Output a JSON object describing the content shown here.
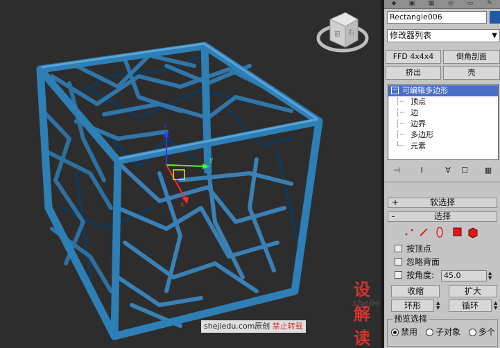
{
  "viewport": {
    "axis_x": "x",
    "axis_y": "y",
    "axis_z": "z",
    "viewcube_labels": [
      "前",
      "右"
    ]
  },
  "panel": {
    "object_name": "Rectangle006",
    "object_color": "#1f5aa6",
    "modifier_list": "修改器列表",
    "buttons": {
      "ffd": "FFD 4x4x4",
      "chamfer_profile": "倒角剖面",
      "extrude": "挤出",
      "shell": "壳"
    },
    "stack": {
      "root": "可编辑多边形",
      "items": [
        "顶点",
        "边",
        "边界",
        "多边形",
        "元素"
      ]
    },
    "rollouts": {
      "soft_selection": {
        "sign": "+",
        "label": "软选择"
      },
      "selection": {
        "sign": "-",
        "label": "选择"
      }
    },
    "options": {
      "by_vertex": "按顶点",
      "ignore_backfacing": "忽略背面",
      "by_angle": "按角度:",
      "angle_value": "45.0",
      "shrink": "收缩",
      "grow": "扩大",
      "ring": "环形",
      "loop": "循环",
      "preview_selection": "预览选择",
      "disable": "禁用",
      "subobject": "子对象",
      "multi": "多个"
    }
  },
  "watermark": {
    "brand": "设解读",
    "site": "shejiedu.com",
    "credit_prefix": "shejiedu.com原创",
    "credit_warning": "禁止转载"
  }
}
